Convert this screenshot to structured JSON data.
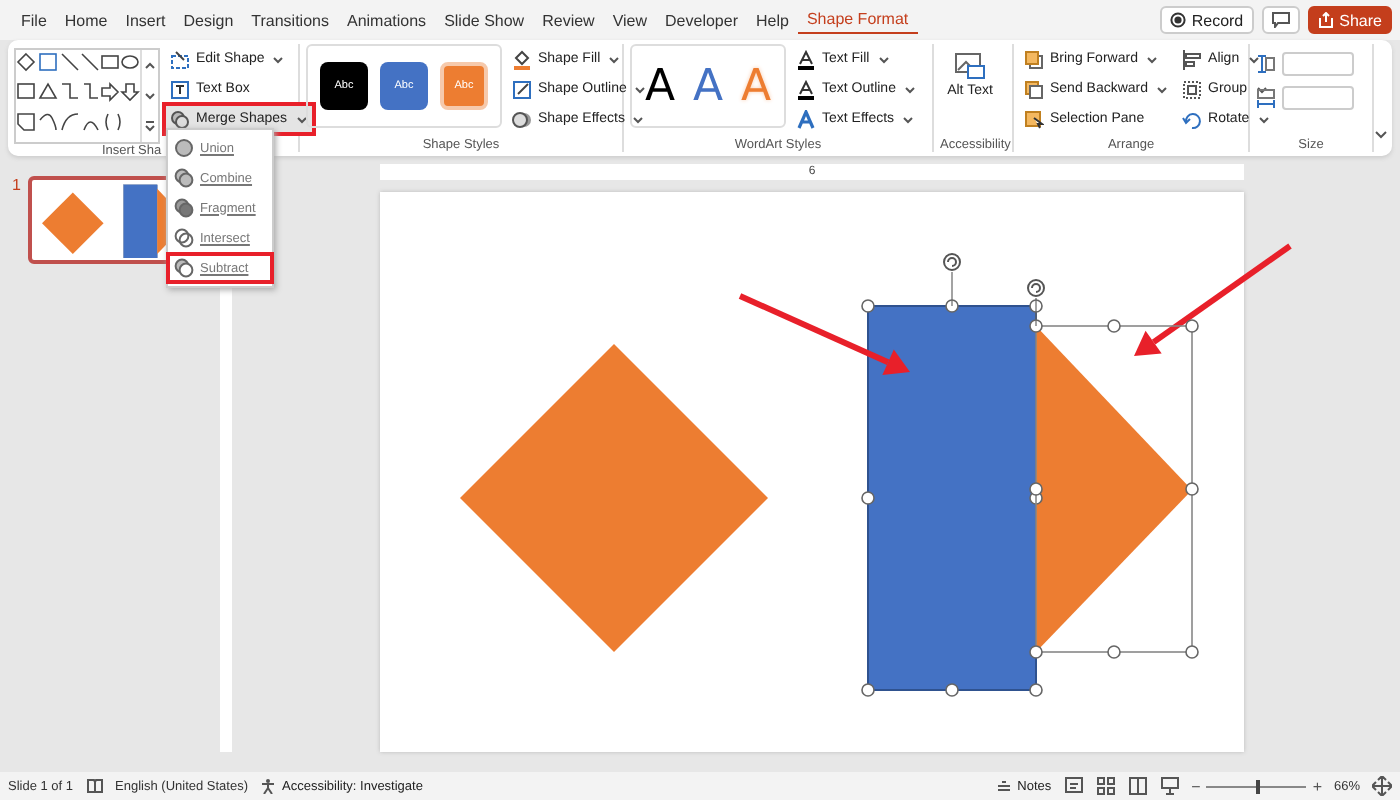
{
  "tabs": [
    {
      "label": "File",
      "selected": false
    },
    {
      "label": "Home",
      "selected": false
    },
    {
      "label": "Insert",
      "selected": false
    },
    {
      "label": "Design",
      "selected": false
    },
    {
      "label": "Transitions",
      "selected": false
    },
    {
      "label": "Animations",
      "selected": false
    },
    {
      "label": "Slide Show",
      "selected": false
    },
    {
      "label": "Review",
      "selected": false
    },
    {
      "label": "View",
      "selected": false
    },
    {
      "label": "Developer",
      "selected": false
    },
    {
      "label": "Help",
      "selected": false
    },
    {
      "label": "Shape Format",
      "selected": true
    }
  ],
  "title_buttons": {
    "record": "Record",
    "share": "Share"
  },
  "ribbon": {
    "insert_shapes": {
      "label": "Insert Sha",
      "buttons": [
        {
          "label": "Edit Shape",
          "highlighted": false
        },
        {
          "label": "Text Box",
          "highlighted": false
        },
        {
          "label": "Merge Shapes",
          "highlighted": true
        }
      ]
    },
    "shape_styles": {
      "label": "Shape Styles",
      "swatches": [
        {
          "text": "Abc",
          "color": "#000000",
          "selected": false
        },
        {
          "text": "Abc",
          "color": "#4472c4",
          "selected": false
        },
        {
          "text": "Abc",
          "color": "#ed7d31",
          "selected": true
        }
      ],
      "buttons": [
        "Shape Fill",
        "Shape Outline",
        "Shape Effects"
      ]
    },
    "wordart_styles": {
      "label": "WordArt Styles",
      "samples": [
        {
          "text": "A",
          "kind": "solid",
          "color": "#000000"
        },
        {
          "text": "A",
          "kind": "solid",
          "color": "#4472c4"
        },
        {
          "text": "A",
          "kind": "outline",
          "color": "#ed7d31"
        }
      ],
      "buttons": [
        "Text Fill",
        "Text Outline",
        "Text Effects"
      ]
    },
    "accessibility": {
      "label": "Accessibility",
      "button": "Alt Text"
    },
    "arrange": {
      "label": "Arrange",
      "buttons": [
        "Bring Forward",
        "Send Backward",
        "Selection Pane",
        "Align",
        "Group",
        "Rotate"
      ]
    },
    "size": {
      "label": "Size"
    }
  },
  "merge_menu": [
    {
      "label": "Union",
      "highlighted": false
    },
    {
      "label": "Combine",
      "highlighted": false
    },
    {
      "label": "Fragment",
      "highlighted": false
    },
    {
      "label": "Intersect",
      "highlighted": false
    },
    {
      "label": "Subtract",
      "highlighted": true
    }
  ],
  "slide_panel": {
    "number": "1",
    "selected": true
  },
  "ruler": {
    "label": "6"
  },
  "slide_shapes": [
    {
      "kind": "diamond",
      "color": "#ed7d31"
    },
    {
      "kind": "rectangle",
      "color": "#4472c4",
      "selected": true
    },
    {
      "kind": "triangle",
      "color": "#ed7d31",
      "selected": true
    },
    {
      "kind": "arrow",
      "color": "#e8202a"
    },
    {
      "kind": "arrow",
      "color": "#e8202a"
    }
  ],
  "status_bar": {
    "slide": "Slide 1 of 1",
    "language": "English (United States)",
    "accessibility": "Accessibility: Investigate",
    "notes": "Notes",
    "zoom_out": "−",
    "zoom_slider": {
      "level": 0.5
    },
    "zoom_in": "+",
    "zoom": "66%"
  }
}
